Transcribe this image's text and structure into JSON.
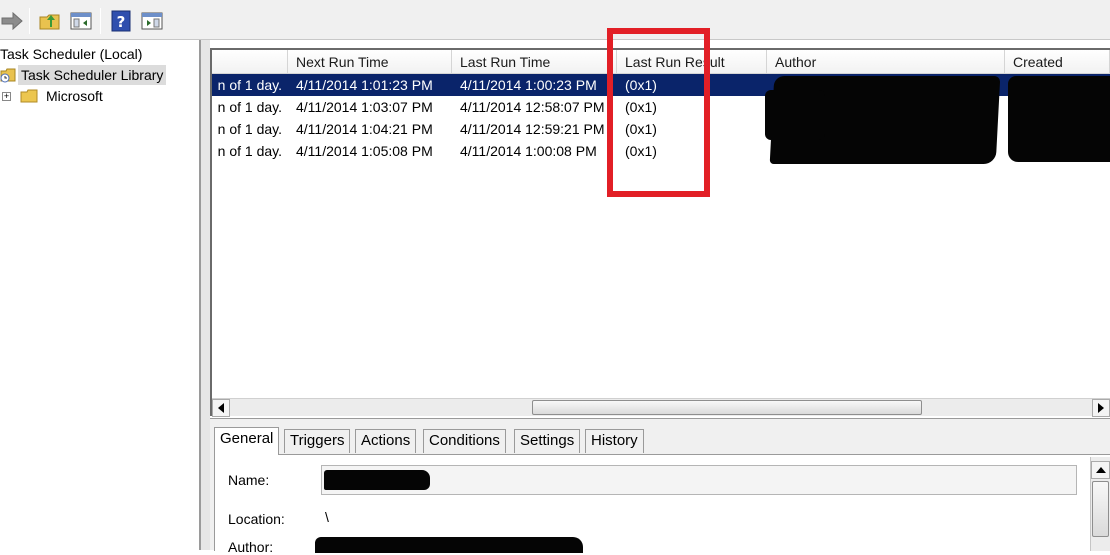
{
  "toolbar": {
    "buttons": [
      {
        "icon": "forward-arrow-icon"
      },
      {
        "icon": "up-folder-icon"
      },
      {
        "icon": "show-hide-console-tree-icon"
      },
      {
        "icon": "help-icon"
      },
      {
        "icon": "show-hide-action-pane-icon"
      }
    ]
  },
  "tree": {
    "root": "Task Scheduler (Local)",
    "library": "Task Scheduler Library",
    "child": "Microsoft",
    "expander": "+"
  },
  "list": {
    "columns": [
      "",
      "Next Run Time",
      "Last Run Time",
      "Last Run Result",
      "Author",
      "Created"
    ],
    "rows": [
      {
        "trigger": "n of 1 day.",
        "next": "4/11/2014 1:01:23 PM",
        "last": "4/11/2014 1:00:23 PM",
        "result": "(0x1)"
      },
      {
        "trigger": "n of 1 day.",
        "next": "4/11/2014 1:03:07 PM",
        "last": "4/11/2014 12:58:07 PM",
        "result": "(0x1)"
      },
      {
        "trigger": "n of 1 day.",
        "next": "4/11/2014 1:04:21 PM",
        "last": "4/11/2014 12:59:21 PM",
        "result": "(0x1)"
      },
      {
        "trigger": "n of 1 day.",
        "next": "4/11/2014 1:05:08 PM",
        "last": "4/11/2014 1:00:08 PM",
        "result": "(0x1)"
      }
    ],
    "selected_row": 0
  },
  "details": {
    "tabs": [
      "General",
      "Triggers",
      "Actions",
      "Conditions",
      "Settings",
      "History"
    ],
    "active_tab": 0,
    "fields": {
      "name_label": "Name:",
      "location_label": "Location:",
      "location_value": "\\",
      "author_label": "Author:"
    }
  },
  "colors": {
    "annotation": "#e21f26",
    "selection": "#0a246a",
    "redaction": "#050505"
  }
}
